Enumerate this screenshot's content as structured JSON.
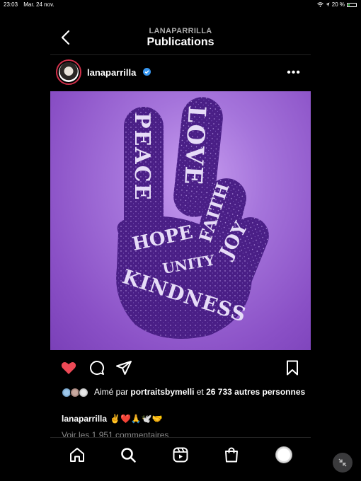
{
  "status_bar": {
    "time": "23:03",
    "date": "Mar. 24 nov.",
    "battery": "20 %"
  },
  "header": {
    "account": "LANAPARRILLA",
    "title": "Publications"
  },
  "post": {
    "username": "lanaparrilla",
    "image_words": {
      "peace": "PEACE",
      "love": "LOVE",
      "faith": "FAITH",
      "hope": "HOPE",
      "unity": "UNITY",
      "joy": "JOY",
      "kindness": "KINDNESS"
    },
    "likes_prefix": "Aimé par",
    "liked_by": "portraitsbymelli",
    "likes_middle": "et",
    "likes_count": "26 733 autres personnes",
    "caption_user": "lanaparrilla",
    "caption_text": "✌️❤️🙏🕊️🤝",
    "comments_link": "Voir les 1 951 commentaires"
  },
  "colors": {
    "like_red": "#ed4956",
    "verified_blue": "#3897f0",
    "hand_purple": "#4a1f86",
    "bg_purple": "#a574db"
  }
}
